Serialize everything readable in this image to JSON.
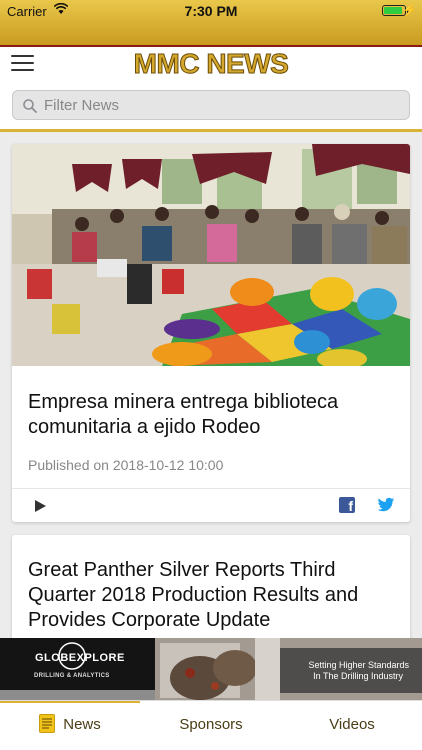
{
  "status_bar": {
    "carrier": "Carrier",
    "time": "7:30 PM",
    "battery_level": 0.9,
    "charging_icon": "bolt-icon"
  },
  "header": {
    "app_logo_text": "MMC NEWS",
    "menu_icon": "hamburger-icon"
  },
  "search": {
    "placeholder": "Filter News",
    "value": "",
    "icon": "search-icon"
  },
  "articles": [
    {
      "title": "Empresa minera entrega biblioteca comunitaria a ejido Rodeo",
      "published": "Published on 2018-10-12 10:00",
      "actions": [
        "play-icon",
        "facebook-icon",
        "twitter-icon"
      ]
    },
    {
      "title": "Great Panther Silver Reports Third Quarter 2018 Production Results and Provides Corporate Update"
    }
  ],
  "ad": {
    "brand": "GLOBEXPLORE",
    "subtitle": "DRILLING & ANALYTICS",
    "tagline_1": "Setting Higher Standards",
    "tagline_2": "In The Drilling Industry"
  },
  "tabs": [
    {
      "label": "News",
      "active": true,
      "icon": "news-icon"
    },
    {
      "label": "Sponsors",
      "active": false
    },
    {
      "label": "Videos",
      "active": false
    }
  ],
  "colors": {
    "accent": "#d9b236",
    "dark_red": "#8a1a14",
    "tab_text": "#4a3d16",
    "facebook": "#3b5998",
    "twitter": "#1da1f2"
  }
}
